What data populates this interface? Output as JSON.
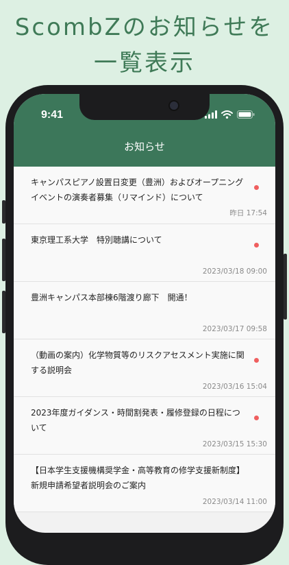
{
  "headline": {
    "line1": "ScombZのお知らせを",
    "line2": "一覧表示"
  },
  "status_bar": {
    "time": "9:41",
    "icons": [
      "signal-icon",
      "wifi-icon",
      "battery-icon"
    ]
  },
  "nav": {
    "title": "お知らせ"
  },
  "notifications": [
    {
      "title": "キャンパスピアノ設置日変更（豊洲）およびオープニングイベントの演奏者募集（リマインド）について",
      "date": "昨日 17:54",
      "unread": true
    },
    {
      "title": "東京理工系大学　特別聴講について",
      "date": "2023/03/18 09:00",
      "unread": true
    },
    {
      "title": "豊洲キャンパス本部棟6階渡り廊下　開通！",
      "date": "2023/03/17 09:58",
      "unread": false
    },
    {
      "title": "（動画の案内）化学物質等のリスクアセスメント実施に関する説明会",
      "date": "2023/03/16 15:04",
      "unread": true
    },
    {
      "title": "2023年度ガイダンス・時間割発表・履修登録の日程について",
      "date": "2023/03/15 15:30",
      "unread": true
    },
    {
      "title": "【日本学生支援機構奨学金・高等教育の修学支援新制度】　新規申請希望者説明会のご案内",
      "date": "2023/03/14 11:00",
      "unread": false
    }
  ],
  "colors": {
    "accent": "#3c775a",
    "unread_dot": "#ef5f5f",
    "background": "#ddf0e3"
  }
}
